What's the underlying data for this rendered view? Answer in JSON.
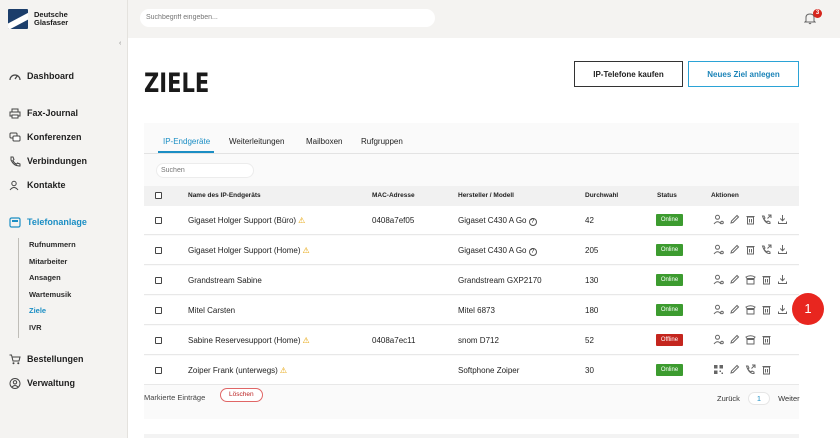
{
  "brand": {
    "line1": "Deutsche",
    "line2": "Glasfaser"
  },
  "topbar": {
    "search_placeholder": "Suchbegriff eingeben...",
    "notification_count": "3"
  },
  "nav": {
    "dashboard": "Dashboard",
    "fax": "Fax-Journal",
    "konferenzen": "Konferenzen",
    "verbindungen": "Verbindungen",
    "kontakte": "Kontakte",
    "telefonanlage": "Telefonanlage",
    "sub": [
      "Rufnummern",
      "Mitarbeiter",
      "Ansagen",
      "Wartemusik",
      "Ziele",
      "IVR"
    ],
    "bestellungen": "Bestellungen",
    "verwaltung": "Verwaltung"
  },
  "page": {
    "title": "ZIELE",
    "btn_buy": "IP-Telefone kaufen",
    "btn_new": "Neues Ziel anlegen"
  },
  "tabs": [
    "IP-Endgeräte",
    "Weiterleitungen",
    "Mailboxen",
    "Rufgruppen"
  ],
  "table": {
    "search_placeholder": "Suchen",
    "headers": {
      "name": "Name des IP-Endgeräts",
      "mac": "MAC-Adresse",
      "vendor": "Hersteller / Modell",
      "ext": "Durchwahl",
      "status": "Status",
      "actions": "Aktionen"
    },
    "rows": [
      {
        "name": "Gigaset Holger Support (Büro)",
        "mac": "0408a7ef05",
        "vendor": "Gigaset C430 A Go",
        "ext": "42",
        "status": "Online"
      },
      {
        "name": "Gigaset Holger Support (Home)",
        "mac": "",
        "vendor": "Gigaset C430 A Go",
        "ext": "205",
        "status": "Online"
      },
      {
        "name": "Grandstream Sabine",
        "mac": "",
        "vendor": "Grandstream GXP2170",
        "ext": "130",
        "status": "Online"
      },
      {
        "name": "Mitel Carsten",
        "mac": "",
        "vendor": "Mitel 6873",
        "ext": "180",
        "status": "Online"
      },
      {
        "name": "Sabine Reservesupport (Home)",
        "mac": "0408a7ec11",
        "vendor": "snom D712",
        "ext": "52",
        "status": "Offline"
      },
      {
        "name": "Zoiper Frank (unterwegs)",
        "mac": "",
        "vendor": "Softphone Zoiper",
        "ext": "30",
        "status": "Online"
      }
    ]
  },
  "footer": {
    "marked": "Markierte Einträge",
    "delete": "Löschen",
    "back": "Zurück",
    "page": "1",
    "next": "Weiter"
  },
  "marker": "1",
  "colors": {
    "accent": "#1b8ec4",
    "online": "#3c9b2f",
    "offline": "#c4261e",
    "warning": "#e6a100"
  }
}
